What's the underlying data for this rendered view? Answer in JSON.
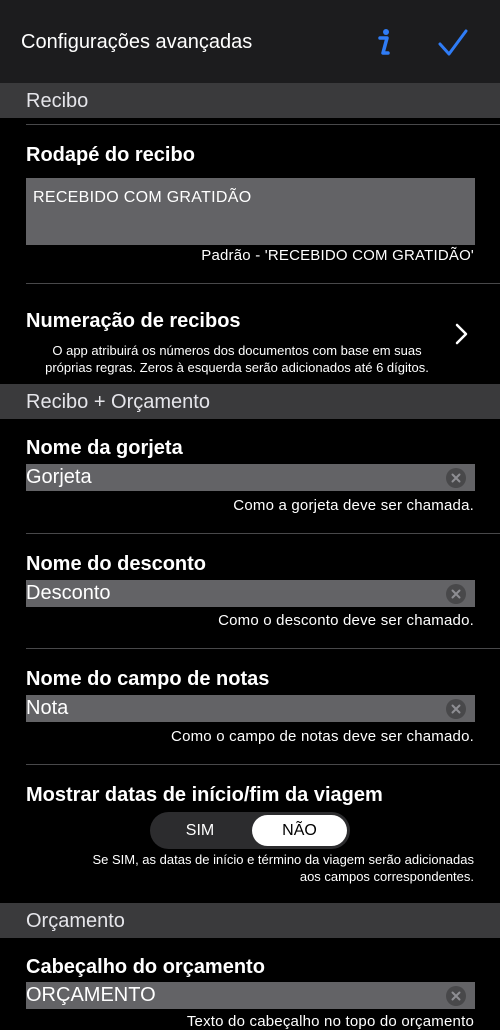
{
  "nav": {
    "title": "Configurações avançadas"
  },
  "sections": {
    "recibo": "Recibo",
    "recibo_orcamento": "Recibo + Orçamento",
    "orcamento": "Orçamento"
  },
  "rodape": {
    "label": "Rodapé do recibo",
    "value": "RECEBIDO COM GRATIDÃO",
    "help": "Padrão - 'RECEBIDO COM GRATIDÃO'"
  },
  "numeracao": {
    "label": "Numeração de recibos",
    "desc_line1": "O app atribuirá os números dos documentos com base em suas",
    "desc_line2": "próprias regras. Zeros à esquerda serão adicionados até 6 dígitos."
  },
  "gorjeta": {
    "label": "Nome da gorjeta",
    "value": "Gorjeta",
    "help": "Como a gorjeta deve ser chamada."
  },
  "desconto": {
    "label": "Nome do desconto",
    "value": "Desconto",
    "help": "Como o desconto deve ser chamado."
  },
  "notas": {
    "label": "Nome do campo de notas",
    "value": "Nota",
    "help": "Como o campo de notas deve ser chamado."
  },
  "datas": {
    "label": "Mostrar datas de início/fim da viagem",
    "option_sim": "SIM",
    "option_nao": "NÃO",
    "selected": "NÃO",
    "desc_line1": "Se SIM, as datas de início e término da viagem serão adicionadas",
    "desc_line2": "aos campos correspondentes."
  },
  "cabecalho": {
    "label": "Cabeçalho do orçamento",
    "value": "ORÇAMENTO",
    "help": "Texto do cabeçalho no topo do orçamento"
  },
  "icons": {
    "info": "info-icon",
    "check": "checkmark-icon",
    "chevron": "chevron-right-icon",
    "clear": "clear-circle-icon"
  },
  "colors": {
    "accent": "#2f7cf6",
    "navbar": "#1c1c1e",
    "section": "#3a3a3c",
    "field": "#636366"
  }
}
